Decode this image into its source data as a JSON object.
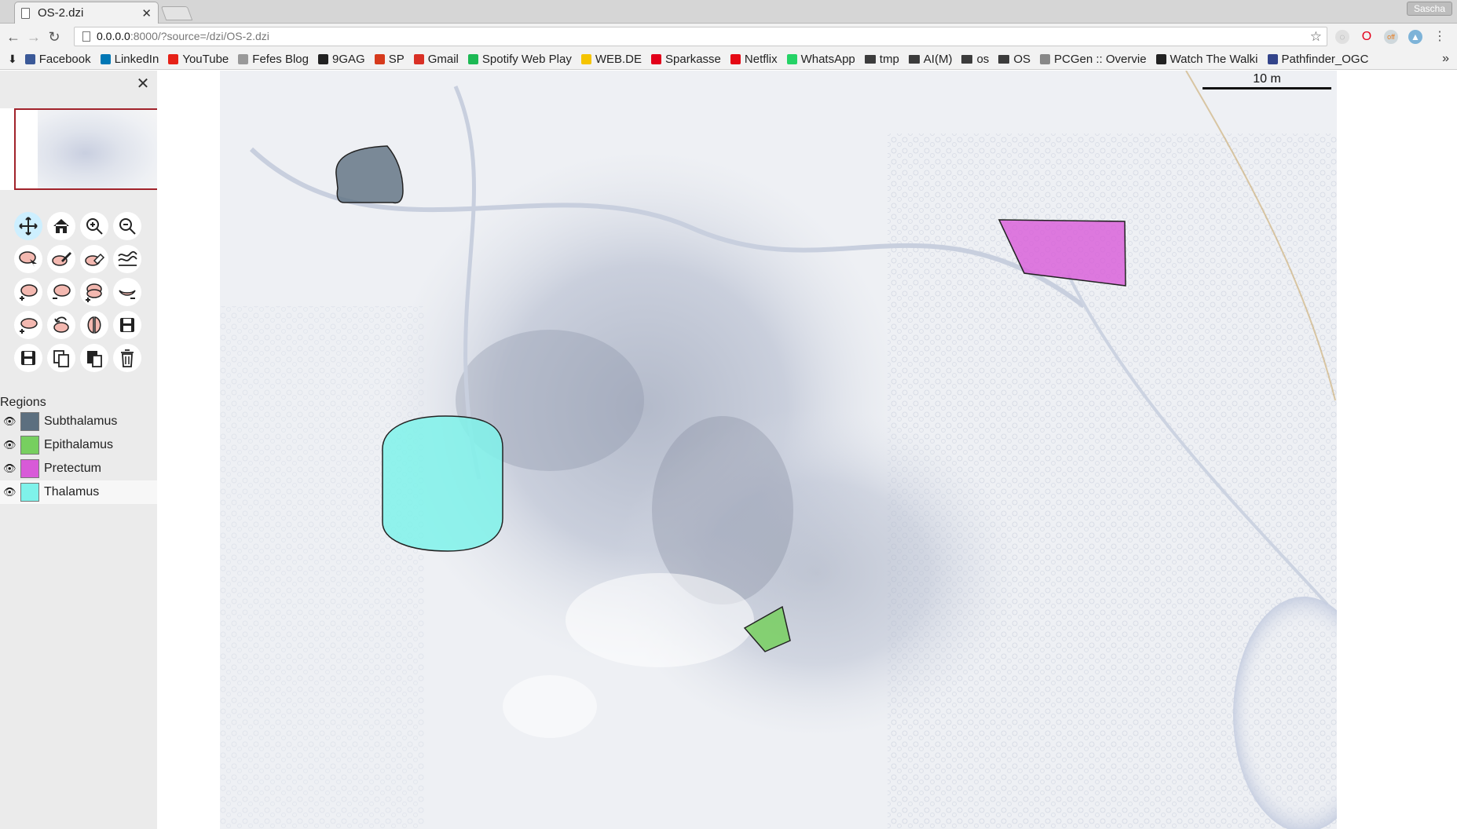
{
  "browser": {
    "tab_title": "OS-2.dzi",
    "profile": "Sascha",
    "url_host": "0.0.0.0",
    "url_path": ":8000/?source=/dzi/OS-2.dzi",
    "bookmarks": [
      {
        "label": "Facebook",
        "color": "#3b5998"
      },
      {
        "label": "LinkedIn",
        "color": "#0077b5"
      },
      {
        "label": "YouTube",
        "color": "#e62117"
      },
      {
        "label": "Fefes Blog",
        "color": "#999999"
      },
      {
        "label": "9GAG",
        "color": "#222222"
      },
      {
        "label": "SP",
        "color": "#d63a1c"
      },
      {
        "label": "Gmail",
        "color": "#d93025"
      },
      {
        "label": "Spotify Web Play",
        "color": "#1db954"
      },
      {
        "label": "WEB.DE",
        "color": "#f5c400"
      },
      {
        "label": "Sparkasse",
        "color": "#e2001a"
      },
      {
        "label": "Netflix",
        "color": "#e50914"
      },
      {
        "label": "WhatsApp",
        "color": "#25d366"
      },
      {
        "label": "tmp",
        "folder": true
      },
      {
        "label": "AI(M)",
        "folder": true
      },
      {
        "label": "os",
        "folder": true
      },
      {
        "label": "OS",
        "folder": true
      },
      {
        "label": "PCGen :: Overvie",
        "color": "#888888"
      },
      {
        "label": "Watch The Walki",
        "color": "#222222"
      },
      {
        "label": "Pathfinder_OGC",
        "color": "#33448a"
      }
    ]
  },
  "sidebar": {
    "close_icon": "close-icon",
    "tools": [
      {
        "name": "pan-tool",
        "active": true
      },
      {
        "name": "home-view"
      },
      {
        "name": "zoom-in"
      },
      {
        "name": "zoom-out"
      },
      {
        "name": "select-region"
      },
      {
        "name": "draw-region"
      },
      {
        "name": "erase-region"
      },
      {
        "name": "smooth-region"
      },
      {
        "name": "add-region"
      },
      {
        "name": "remove-region"
      },
      {
        "name": "union-region"
      },
      {
        "name": "subtract-region"
      },
      {
        "name": "add-point"
      },
      {
        "name": "rotate-region"
      },
      {
        "name": "split-region"
      },
      {
        "name": "save-region"
      },
      {
        "name": "save-file"
      },
      {
        "name": "copy-region"
      },
      {
        "name": "paste-region"
      },
      {
        "name": "delete-region"
      }
    ],
    "regions_title": "Regions",
    "regions": [
      {
        "label": "Subthalamus",
        "color": "#5c6f7f"
      },
      {
        "label": "Epithalamus",
        "color": "#77cf5f"
      },
      {
        "label": "Pretectum",
        "color": "#d85ad8"
      },
      {
        "label": "Thalamus",
        "color": "#7ff2ea"
      }
    ]
  },
  "viewer": {
    "scalebar_label": "10 m"
  }
}
